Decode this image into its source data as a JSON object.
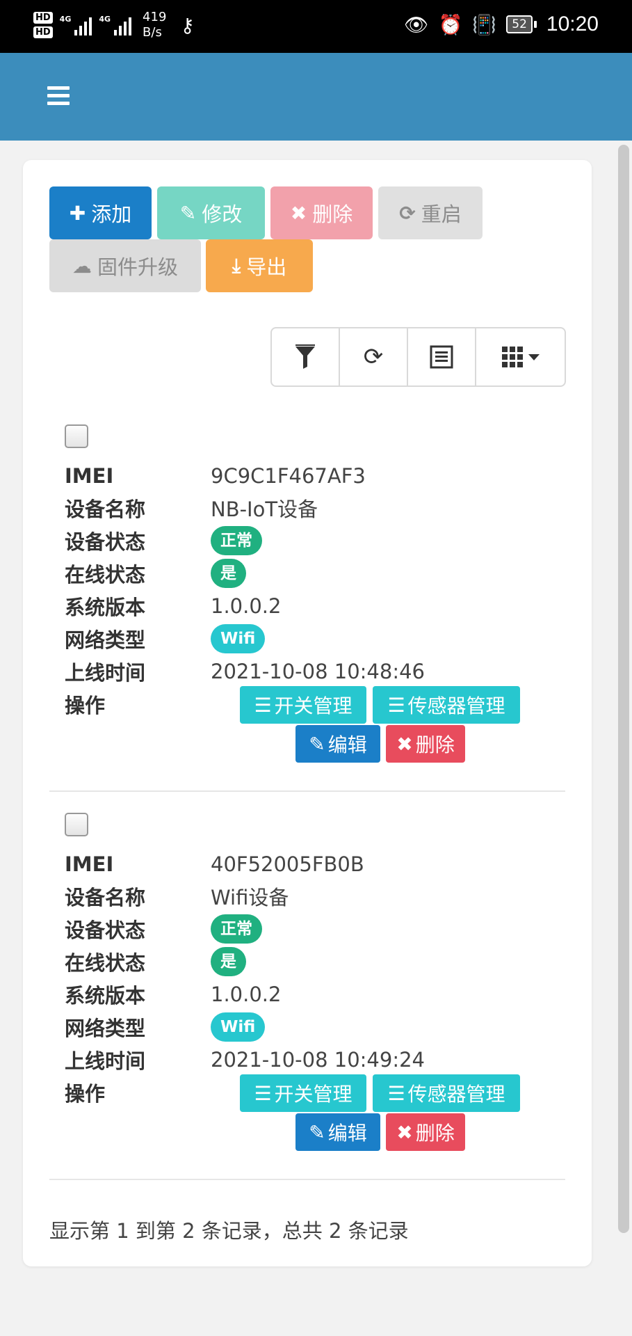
{
  "status_bar": {
    "hd1": "HD",
    "hd2": "HD",
    "net1": "4G",
    "net2": "4G",
    "speed_value": "419",
    "speed_unit": "B/s",
    "battery": "52",
    "time": "10:20"
  },
  "toolbar": {
    "add_label": "添加",
    "edit_label": "修改",
    "delete_label": "删除",
    "restart_label": "重启",
    "firmware_label": "固件升级",
    "export_label": "导出"
  },
  "records": [
    {
      "labels": {
        "imei": "IMEI",
        "name": "设备名称",
        "status": "设备状态",
        "online": "在线状态",
        "version": "系统版本",
        "network": "网络类型",
        "online_time": "上线时间",
        "actions": "操作"
      },
      "imei": "9C9C1F467AF3",
      "name": "NB-IoT设备",
      "status": "正常",
      "online": "是",
      "version": "1.0.0.2",
      "network": "Wifi",
      "online_time": "2021-10-08 10:48:46",
      "actions": {
        "switch": "开关管理",
        "sensor": "传感器管理",
        "edit": "编辑",
        "delete": "删除"
      }
    },
    {
      "labels": {
        "imei": "IMEI",
        "name": "设备名称",
        "status": "设备状态",
        "online": "在线状态",
        "version": "系统版本",
        "network": "网络类型",
        "online_time": "上线时间",
        "actions": "操作"
      },
      "imei": "40F52005FB0B",
      "name": "Wifi设备",
      "status": "正常",
      "online": "是",
      "version": "1.0.0.2",
      "network": "Wifi",
      "online_time": "2021-10-08 10:49:24",
      "actions": {
        "switch": "开关管理",
        "sensor": "传感器管理",
        "edit": "编辑",
        "delete": "删除"
      }
    }
  ],
  "pagination_text": "显示第 1 到第 2 条记录，总共 2 条记录",
  "colors": {
    "app_bar": "#3c8dbc",
    "primary": "#1b7fc8",
    "success": "#20b080",
    "info": "#27c7cf",
    "danger": "#e84c5d",
    "warning": "#f7a94d"
  }
}
